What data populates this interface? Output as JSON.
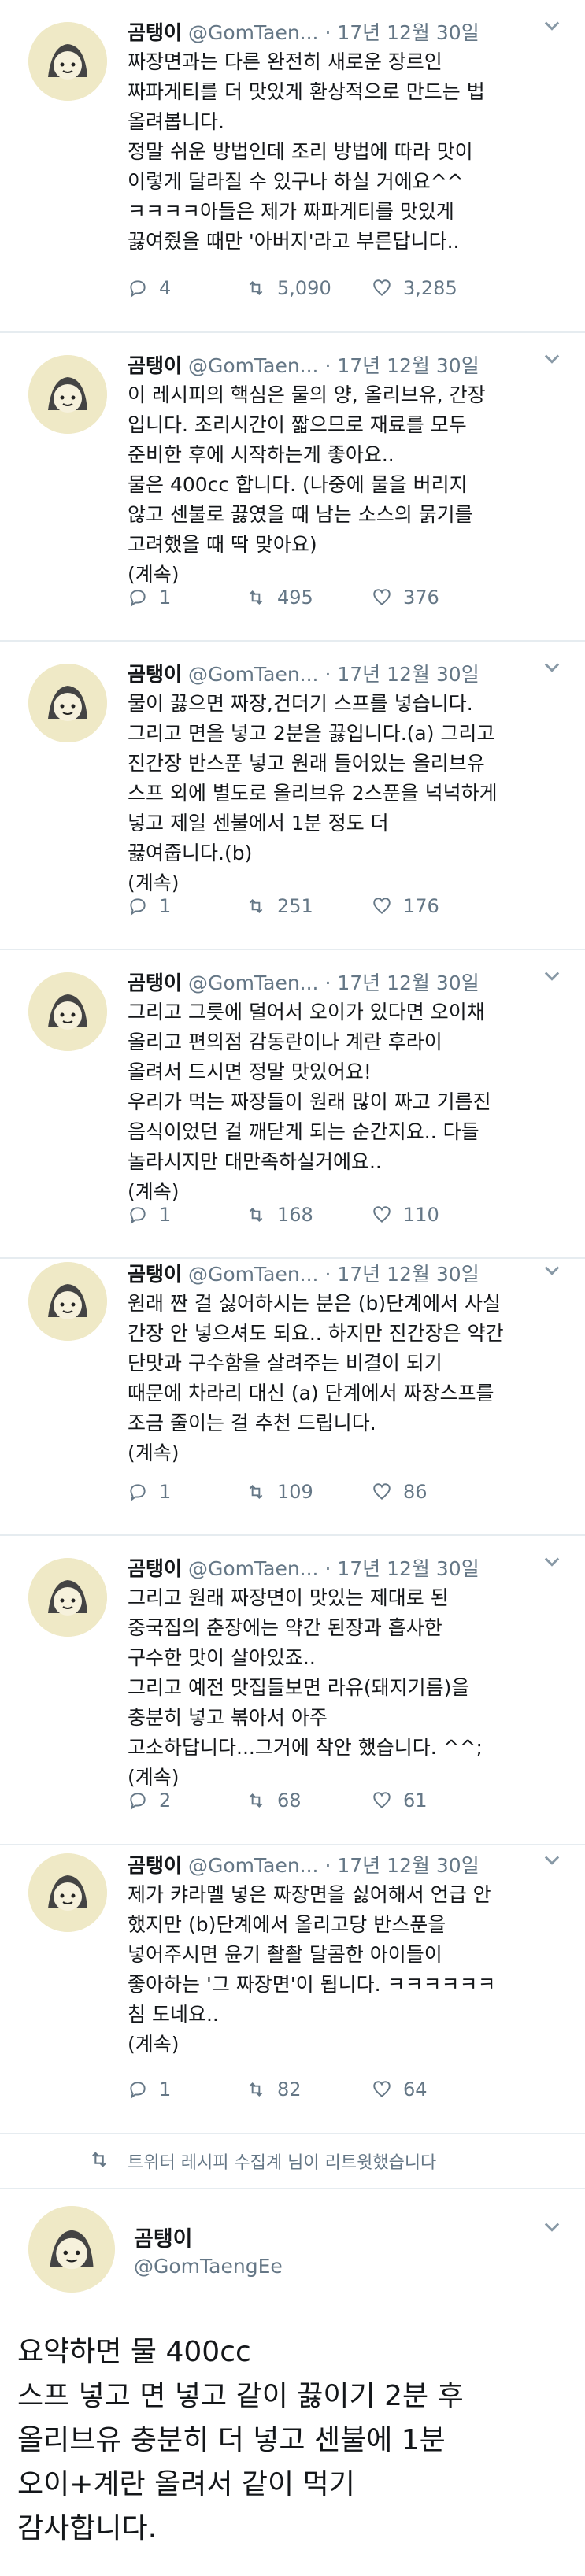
{
  "tweets": [
    {
      "name": "곰탱이",
      "handle": "@GomTaen...",
      "time": "· 17년 12월 30일",
      "text": "짜장면과는 다른 완전히 새로운 장르인\n짜파게티를 더 맛있게 환상적으로 만드는 법\n올려봅니다.\n정말 쉬운 방법인데 조리 방법에 따라 맛이\n이렇게 달라질 수 있구나 하실 거에요^^\nㅋㅋㅋㅋ아들은 제가 짜파게티를 맛있게\n끓여줬을 때만 '아버지'라고 부른답니다..",
      "replies": "4",
      "retweets": "5,090",
      "likes": "3,285"
    },
    {
      "name": "곰탱이",
      "handle": "@GomTaen...",
      "time": "· 17년 12월 30일",
      "text": "이 레시피의 핵심은 물의 양, 올리브유, 간장\n입니다. 조리시간이 짧으므로 재료를 모두\n준비한 후에 시작하는게 좋아요..\n물은 400cc 합니다. (나중에 물을 버리지\n않고 센불로 끓였을 때 남는 소스의 묽기를\n고려했을 때 딱 맞아요)\n(계속)",
      "replies": "1",
      "retweets": "495",
      "likes": "376"
    },
    {
      "name": "곰탱이",
      "handle": "@GomTaen...",
      "time": "· 17년 12월 30일",
      "text": "물이 끓으면 짜장,건더기 스프를 넣습니다.\n그리고 면을 넣고 2분을 끓입니다.(a) 그리고\n진간장 반스푼 넣고 원래 들어있는 올리브유\n스프 외에 별도로 올리브유 2스푼을 넉넉하게\n넣고 제일 센불에서 1분 정도 더\n끓여줍니다.(b)\n(계속)",
      "replies": "1",
      "retweets": "251",
      "likes": "176"
    },
    {
      "name": "곰탱이",
      "handle": "@GomTaen...",
      "time": "· 17년 12월 30일",
      "text": "그리고 그릇에 덜어서 오이가 있다면 오이채\n올리고 편의점 감동란이나 계란 후라이\n올려서 드시면 정말 맛있어요!\n우리가 먹는 짜장들이 원래 많이 짜고 기름진\n음식이었던 걸 깨닫게 되는 순간지요.. 다들\n놀라시지만 대만족하실거에요..\n(계속)",
      "replies": "1",
      "retweets": "168",
      "likes": "110"
    },
    {
      "name": "곰탱이",
      "handle": "@GomTaen...",
      "time": "· 17년 12월 30일",
      "text": "원래 짠 걸 싫어하시는 분은 (b)단계에서 사실\n간장 안 넣으셔도 되요.. 하지만 진간장은 약간\n단맛과 구수함을 살려주는 비결이 되기\n때문에 차라리 대신 (a) 단계에서 짜장스프를\n조금 줄이는 걸 추천 드립니다.\n(계속)",
      "replies": "1",
      "retweets": "109",
      "likes": "86"
    },
    {
      "name": "곰탱이",
      "handle": "@GomTaen...",
      "time": "· 17년 12월 30일",
      "text": "그리고 원래 짜장면이 맛있는 제대로 된\n중국집의 춘장에는 약간 된장과 흡사한\n구수한 맛이 살아있죠..\n그리고 예전 맛집들보면 라유(돼지기름)을\n충분히 넣고 볶아서 아주\n고소하답니다...그거에 착안 했습니다. ^^;\n(계속)",
      "replies": "2",
      "retweets": "68",
      "likes": "61"
    },
    {
      "name": "곰탱이",
      "handle": "@GomTaen...",
      "time": "· 17년 12월 30일",
      "text": "제가 캬라멜 넣은 짜장면을 싫어해서 언급 안\n했지만 (b)단계에서 올리고당 반스푼을\n넣어주시면 윤기 촬촬 달콤한 아이들이\n좋아하는 '그 짜장면'이 됩니다. ㅋㅋㅋㅋㅋㅋ\n침 도네요..\n(계속)",
      "replies": "1",
      "retweets": "82",
      "likes": "64"
    }
  ],
  "retweet_banner": "트위터 레시피 수집계 님이 리트윗했습니다",
  "final_tweet": {
    "name": "곰탱이",
    "handle": "@GomTaengEe",
    "text": "요약하면 물 400cc\n스프 넣고 면 넣고 같이 끓이기 2분 후\n올리브유 충분히 더 넣고 센불에 1분\n오이+계란 올려서 같이 먹기\n감사합니다."
  },
  "icons": [
    "reply-icon",
    "retweet-icon",
    "like-icon",
    "chevron-down-icon"
  ]
}
